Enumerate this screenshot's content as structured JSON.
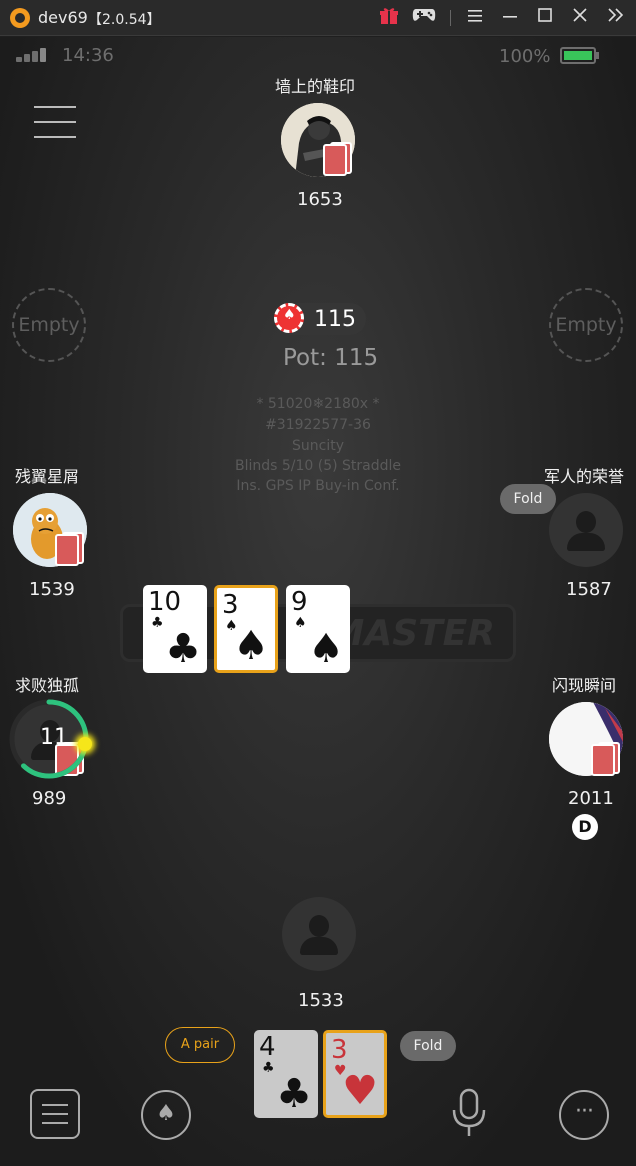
{
  "window": {
    "title": "dev69",
    "version": "【2.0.54】",
    "icons": [
      "gift-icon",
      "gamepad-icon",
      "menu-icon",
      "minimize-icon",
      "maximize-icon",
      "close-icon",
      "expand-icon"
    ]
  },
  "status_bar": {
    "time": "14:36",
    "battery": "100%",
    "battery_level": 1.0,
    "accent": "#39c45a"
  },
  "table_info": {
    "pot_chips": "115",
    "pot_label": "Pot: 115",
    "room_code": "* 51020❄2180x *",
    "table_id": "#31922577-36",
    "club": "Suncity",
    "blinds": "Blinds 5/10 (5) Straddle",
    "rules": "Ins. GPS IP Buy-in Conf."
  },
  "seats": {
    "top": {
      "name": "墙上的鞋印",
      "chips": "1653"
    },
    "left_empty": {
      "label": "Empty"
    },
    "right_empty": {
      "label": "Empty"
    },
    "left_upper": {
      "name": "残翼星屑",
      "chips": "1539"
    },
    "right_upper": {
      "name": "军人的荣誉",
      "chips": "1587",
      "action": "Fold"
    },
    "left_lower": {
      "name": "求败独孤",
      "chips": "989",
      "timer": "11",
      "timer_progress": 0.62,
      "timer_color": "#2ec27e"
    },
    "right_lower": {
      "name": "闪现瞬间",
      "chips": "2011",
      "dealer": "D"
    },
    "hero": {
      "chips": "1533",
      "hand_rank": "A pair",
      "action": "Fold"
    }
  },
  "board": [
    {
      "rank": "10",
      "suit": "♣",
      "highlight": false
    },
    {
      "rank": "3",
      "suit": "♠",
      "highlight": true
    },
    {
      "rank": "9",
      "suit": "♠",
      "highlight": false
    }
  ],
  "hero_cards": [
    {
      "rank": "4",
      "suit": "♣",
      "color": "black",
      "highlight": false
    },
    {
      "rank": "3",
      "suit": "♥",
      "color": "red",
      "highlight": true
    }
  ],
  "watermark": "MASTER",
  "bottom_bar": {
    "icons": [
      "hand-history-icon",
      "spade-icon",
      "microphone-icon",
      "chat-icon"
    ]
  },
  "colors": {
    "highlight": "#e8a21a",
    "card_back": "#d85a5a",
    "chip_red": "#e33333"
  }
}
